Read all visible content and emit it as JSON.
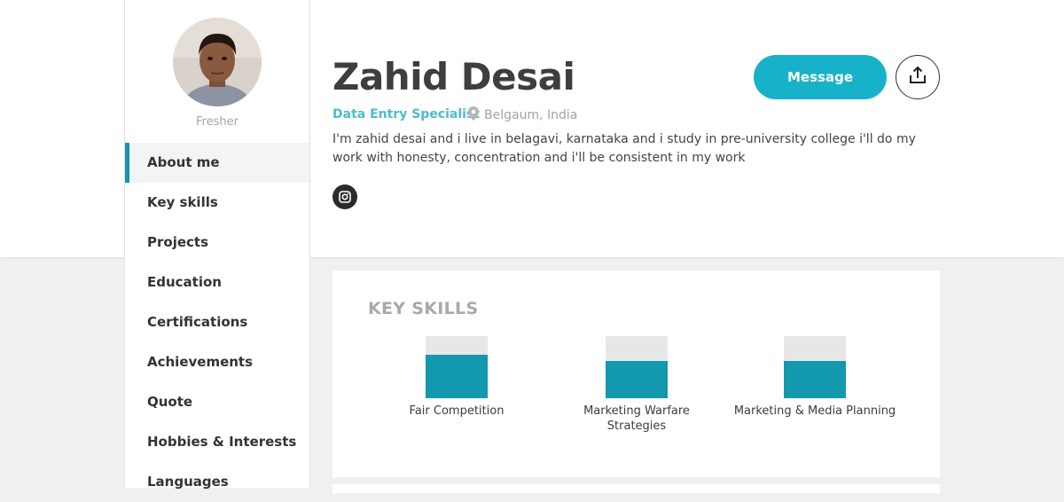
{
  "profile": {
    "name": "Zahid Desai",
    "experience": "Fresher",
    "role": "Data Entry Specialist",
    "location": "Belgaum, India",
    "about": "I'm zahid desai and i live in belagavi, karnataka and i study in pre-university college i'll do my work with honesty, concentration and i'll be consistent in my work"
  },
  "actions": {
    "message_label": "Message"
  },
  "nav": {
    "items": [
      {
        "label": "About me",
        "active": true
      },
      {
        "label": "Key skills"
      },
      {
        "label": "Projects"
      },
      {
        "label": "Education"
      },
      {
        "label": "Certifications"
      },
      {
        "label": "Achievements"
      },
      {
        "label": "Quote"
      },
      {
        "label": "Hobbies & Interests"
      },
      {
        "label": "Languages"
      }
    ]
  },
  "skills": {
    "title": "KEY SKILLS",
    "items": [
      {
        "label": "Fair Competition",
        "level": 0.7
      },
      {
        "label": "Marketing Warfare Strategies",
        "level": 0.6
      },
      {
        "label": "Marketing & Media Planning",
        "level": 0.6
      }
    ]
  },
  "icons": {
    "location": "map-pin-icon",
    "social": "instagram-icon",
    "share": "share-upload-icon"
  },
  "colors": {
    "accent": "#17b2c9",
    "role_text": "#4bbdcf",
    "skill_fill": "#1299ad",
    "skill_track": "#e7e7e9"
  }
}
